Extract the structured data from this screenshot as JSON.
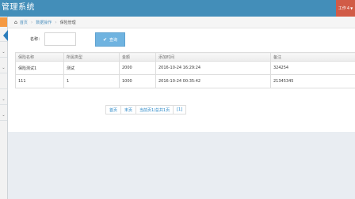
{
  "app": {
    "title": "管理系统"
  },
  "navbar": {
    "right_label": "工作",
    "right_count": "4"
  },
  "sidebar": {
    "chevron": "⌄"
  },
  "breadcrumb": {
    "home_icon": "home-icon",
    "home": "首页",
    "section": "数据操作",
    "current": "保险管理",
    "separator": "›"
  },
  "search": {
    "label": "名称：",
    "value": "",
    "placeholder": "",
    "button_label": "查询",
    "button_icon": "✔"
  },
  "table": {
    "headers": [
      "保险名称",
      "所属类型",
      "金额",
      "添加时间",
      "备注"
    ],
    "rows": [
      [
        "保险测试1",
        "测试",
        "2000",
        "2016-10-24 16:29:24",
        "324254"
      ],
      [
        "111",
        "1",
        "1000",
        "2016-10-24 00:35:42",
        "21345345"
      ]
    ]
  },
  "pagination": {
    "first": "首页",
    "last": "末页",
    "info": "当前页1/总共1页",
    "page": "[1]"
  },
  "colors": {
    "navbar": "#438eb9",
    "accent_button": "#6fb3e0",
    "sidebar_toggle": "#f59942",
    "link": "#4c8fbd"
  }
}
